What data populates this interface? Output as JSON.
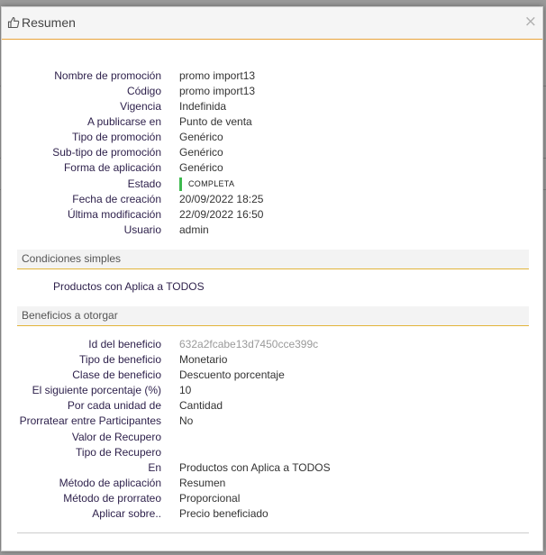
{
  "modal": {
    "title": "Resumen",
    "close_glyph": "×",
    "title_icon": "thumbs-up-icon"
  },
  "summary": [
    {
      "label": "Nombre de promoción",
      "value": "promo import13"
    },
    {
      "label": "Código",
      "value": "promo import13"
    },
    {
      "label": "Vigencia",
      "value": "Indefinida"
    },
    {
      "label": "A publicarse en",
      "value": "Punto de venta"
    },
    {
      "label": "Tipo de promoción",
      "value": "Genérico"
    },
    {
      "label": "Sub-tipo de promoción",
      "value": "Genérico"
    },
    {
      "label": "Forma de aplicación",
      "value": "Genérico"
    },
    {
      "label": "Estado",
      "value": "COMPLETA"
    },
    {
      "label": "Fecha de creación",
      "value": "20/09/2022 18:25"
    },
    {
      "label": "Última modificación",
      "value": "22/09/2022 16:50"
    },
    {
      "label": "Usuario",
      "value": "admin"
    }
  ],
  "conditions": {
    "title": "Condiciones simples",
    "text": "Productos con Aplica a TODOS"
  },
  "benefits": {
    "title": "Beneficios a otorgar",
    "rows": [
      {
        "label": "Id del beneficio",
        "value": "632a2fcabe13d7450cce399c"
      },
      {
        "label": "Tipo de beneficio",
        "value": "Monetario"
      },
      {
        "label": "Clase de beneficio",
        "value": "Descuento porcentaje"
      },
      {
        "label": "El siguiente porcentaje (%)",
        "value": "10"
      },
      {
        "label": "Por cada unidad de",
        "value": "Cantidad"
      },
      {
        "label": "Prorratear entre Participantes",
        "value": "No"
      },
      {
        "label": "Valor de Recupero",
        "value": ""
      },
      {
        "label": "Tipo de Recupero",
        "value": ""
      },
      {
        "label": "En",
        "value": "Productos con Aplica a TODOS"
      },
      {
        "label": "Método de aplicación",
        "value": "Resumen"
      },
      {
        "label": "Método de prorrateo",
        "value": "Proporcional"
      },
      {
        "label": "Aplicar sobre..",
        "value": "Precio beneficiado"
      }
    ]
  },
  "colors": {
    "accent": "#e8a33a",
    "status_green": "#3dba4e",
    "label_text": "#2c1f4a"
  }
}
